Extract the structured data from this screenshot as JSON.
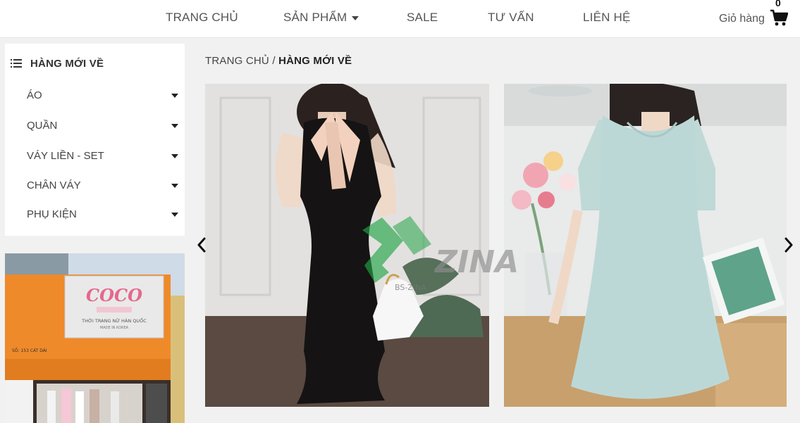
{
  "nav": {
    "items": [
      {
        "label": "TRANG CHỦ"
      },
      {
        "label": "SẢN PHẨM"
      },
      {
        "label": "SALE"
      },
      {
        "label": "TƯ VẤN"
      },
      {
        "label": "LIÊN HỆ"
      }
    ],
    "cart_label": "Giỏ hàng",
    "cart_count": "0"
  },
  "sidebar": {
    "title": "HÀNG MỚI VỀ",
    "items": [
      {
        "label": "ÁO"
      },
      {
        "label": "QUẦN"
      },
      {
        "label": "VÁY LIỀN - SET"
      },
      {
        "label": "CHÂN VÁY"
      },
      {
        "label": "PHỤ KIỆN"
      }
    ]
  },
  "store_sign": {
    "brand": "COCO",
    "tagline": "THỜI TRANG NỮ HÀN QUỐC",
    "made_in": "MADE IN KOREA",
    "address": "SỐ: 153 CÁT DÀI"
  },
  "breadcrumb": {
    "home": "TRANG CHỦ",
    "separator": " / ",
    "current": "HÀNG MỚI VỀ"
  },
  "watermark": {
    "logo": "ZINA",
    "sub": "BS-ZINA"
  },
  "colors": {
    "header_bg": "#ffffff",
    "page_bg": "#f1f1f1",
    "store_facade": "#ef8a2a",
    "watermark_green": "#22a447"
  }
}
